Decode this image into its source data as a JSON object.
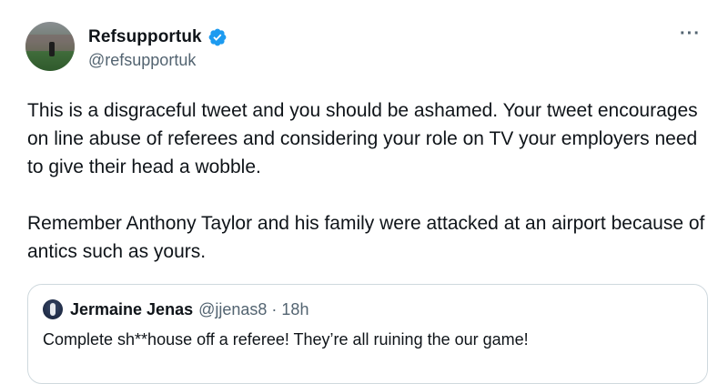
{
  "author": {
    "display_name": "Refsupportuk",
    "handle": "@refsupportuk",
    "verified_icon": "verified-badge-icon",
    "accent_color": "#1d9bf0"
  },
  "menu": {
    "more_label": "···"
  },
  "tweet": {
    "paragraphs": [
      "This is a disgraceful tweet and you should be ashamed. Your tweet encourages on line abuse of referees and considering your role on TV your employers need to give their head a wobble.",
      "Remember Anthony Taylor and his family were attacked at an airport because of antics such as yours."
    ]
  },
  "quoted_tweet": {
    "display_name": "Jermaine Jenas",
    "handle": "@jjenas8",
    "separator": "·",
    "time": "18h",
    "text": "Complete sh**house off a referee! They’re all ruining the our game!"
  }
}
